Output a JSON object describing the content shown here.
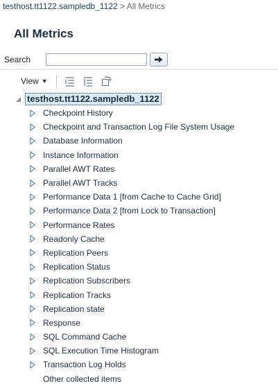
{
  "breadcrumb": {
    "target": "testhost.tt1122.sampledb_1122",
    "separator": ">",
    "current": "All Metrics"
  },
  "page": {
    "title": "All Metrics"
  },
  "search": {
    "label": "Search",
    "value": "",
    "placeholder": ""
  },
  "toolbar": {
    "view_label": "View",
    "icons": [
      "expand-all-icon",
      "collapse-all-icon",
      "detach-icon"
    ]
  },
  "tree": {
    "root": "testhost.tt1122.sampledb_1122",
    "nodes": [
      "Checkpoint History",
      "Checkpoint and Transaction Log File System Usage",
      "Database Information",
      "Instance Information",
      "Parallel AWT Rates",
      "Parallel AWT Tracks",
      "Performance Data 1 [from Cache to Cache Grid]",
      "Performance Data 2 [from Lock to Transaction]",
      "Performance Rates",
      "Readonly Cache",
      "Replication Peers",
      "Replication Status",
      "Replication Subscribers",
      "Replication Tracks",
      "Replication state",
      "Response",
      "SQL Command Cache",
      "SQL Execution Time Histogram",
      "Transaction Log Holds"
    ],
    "leaf": "Other collected items"
  },
  "colors": {
    "accent": "#1f3c5a",
    "selection_bg": "#dbe8f5",
    "arrow": "#4a6d8c"
  }
}
